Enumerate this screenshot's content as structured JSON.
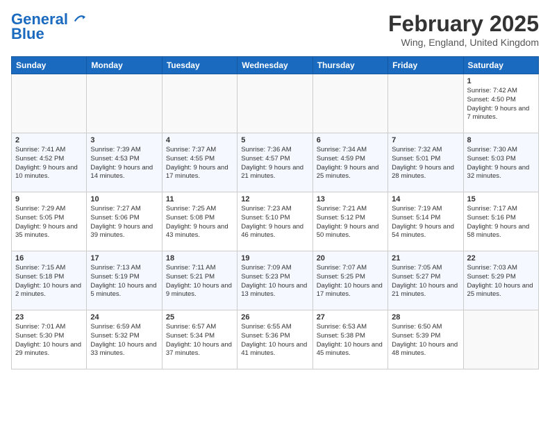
{
  "header": {
    "logo_line1": "General",
    "logo_line2": "Blue",
    "month_title": "February 2025",
    "location": "Wing, England, United Kingdom"
  },
  "weekdays": [
    "Sunday",
    "Monday",
    "Tuesday",
    "Wednesday",
    "Thursday",
    "Friday",
    "Saturday"
  ],
  "weeks": [
    [
      {
        "day": "",
        "text": ""
      },
      {
        "day": "",
        "text": ""
      },
      {
        "day": "",
        "text": ""
      },
      {
        "day": "",
        "text": ""
      },
      {
        "day": "",
        "text": ""
      },
      {
        "day": "",
        "text": ""
      },
      {
        "day": "1",
        "text": "Sunrise: 7:42 AM\nSunset: 4:50 PM\nDaylight: 9 hours and 7 minutes."
      }
    ],
    [
      {
        "day": "2",
        "text": "Sunrise: 7:41 AM\nSunset: 4:52 PM\nDaylight: 9 hours and 10 minutes."
      },
      {
        "day": "3",
        "text": "Sunrise: 7:39 AM\nSunset: 4:53 PM\nDaylight: 9 hours and 14 minutes."
      },
      {
        "day": "4",
        "text": "Sunrise: 7:37 AM\nSunset: 4:55 PM\nDaylight: 9 hours and 17 minutes."
      },
      {
        "day": "5",
        "text": "Sunrise: 7:36 AM\nSunset: 4:57 PM\nDaylight: 9 hours and 21 minutes."
      },
      {
        "day": "6",
        "text": "Sunrise: 7:34 AM\nSunset: 4:59 PM\nDaylight: 9 hours and 25 minutes."
      },
      {
        "day": "7",
        "text": "Sunrise: 7:32 AM\nSunset: 5:01 PM\nDaylight: 9 hours and 28 minutes."
      },
      {
        "day": "8",
        "text": "Sunrise: 7:30 AM\nSunset: 5:03 PM\nDaylight: 9 hours and 32 minutes."
      }
    ],
    [
      {
        "day": "9",
        "text": "Sunrise: 7:29 AM\nSunset: 5:05 PM\nDaylight: 9 hours and 35 minutes."
      },
      {
        "day": "10",
        "text": "Sunrise: 7:27 AM\nSunset: 5:06 PM\nDaylight: 9 hours and 39 minutes."
      },
      {
        "day": "11",
        "text": "Sunrise: 7:25 AM\nSunset: 5:08 PM\nDaylight: 9 hours and 43 minutes."
      },
      {
        "day": "12",
        "text": "Sunrise: 7:23 AM\nSunset: 5:10 PM\nDaylight: 9 hours and 46 minutes."
      },
      {
        "day": "13",
        "text": "Sunrise: 7:21 AM\nSunset: 5:12 PM\nDaylight: 9 hours and 50 minutes."
      },
      {
        "day": "14",
        "text": "Sunrise: 7:19 AM\nSunset: 5:14 PM\nDaylight: 9 hours and 54 minutes."
      },
      {
        "day": "15",
        "text": "Sunrise: 7:17 AM\nSunset: 5:16 PM\nDaylight: 9 hours and 58 minutes."
      }
    ],
    [
      {
        "day": "16",
        "text": "Sunrise: 7:15 AM\nSunset: 5:18 PM\nDaylight: 10 hours and 2 minutes."
      },
      {
        "day": "17",
        "text": "Sunrise: 7:13 AM\nSunset: 5:19 PM\nDaylight: 10 hours and 5 minutes."
      },
      {
        "day": "18",
        "text": "Sunrise: 7:11 AM\nSunset: 5:21 PM\nDaylight: 10 hours and 9 minutes."
      },
      {
        "day": "19",
        "text": "Sunrise: 7:09 AM\nSunset: 5:23 PM\nDaylight: 10 hours and 13 minutes."
      },
      {
        "day": "20",
        "text": "Sunrise: 7:07 AM\nSunset: 5:25 PM\nDaylight: 10 hours and 17 minutes."
      },
      {
        "day": "21",
        "text": "Sunrise: 7:05 AM\nSunset: 5:27 PM\nDaylight: 10 hours and 21 minutes."
      },
      {
        "day": "22",
        "text": "Sunrise: 7:03 AM\nSunset: 5:29 PM\nDaylight: 10 hours and 25 minutes."
      }
    ],
    [
      {
        "day": "23",
        "text": "Sunrise: 7:01 AM\nSunset: 5:30 PM\nDaylight: 10 hours and 29 minutes."
      },
      {
        "day": "24",
        "text": "Sunrise: 6:59 AM\nSunset: 5:32 PM\nDaylight: 10 hours and 33 minutes."
      },
      {
        "day": "25",
        "text": "Sunrise: 6:57 AM\nSunset: 5:34 PM\nDaylight: 10 hours and 37 minutes."
      },
      {
        "day": "26",
        "text": "Sunrise: 6:55 AM\nSunset: 5:36 PM\nDaylight: 10 hours and 41 minutes."
      },
      {
        "day": "27",
        "text": "Sunrise: 6:53 AM\nSunset: 5:38 PM\nDaylight: 10 hours and 45 minutes."
      },
      {
        "day": "28",
        "text": "Sunrise: 6:50 AM\nSunset: 5:39 PM\nDaylight: 10 hours and 48 minutes."
      },
      {
        "day": "",
        "text": ""
      }
    ]
  ]
}
